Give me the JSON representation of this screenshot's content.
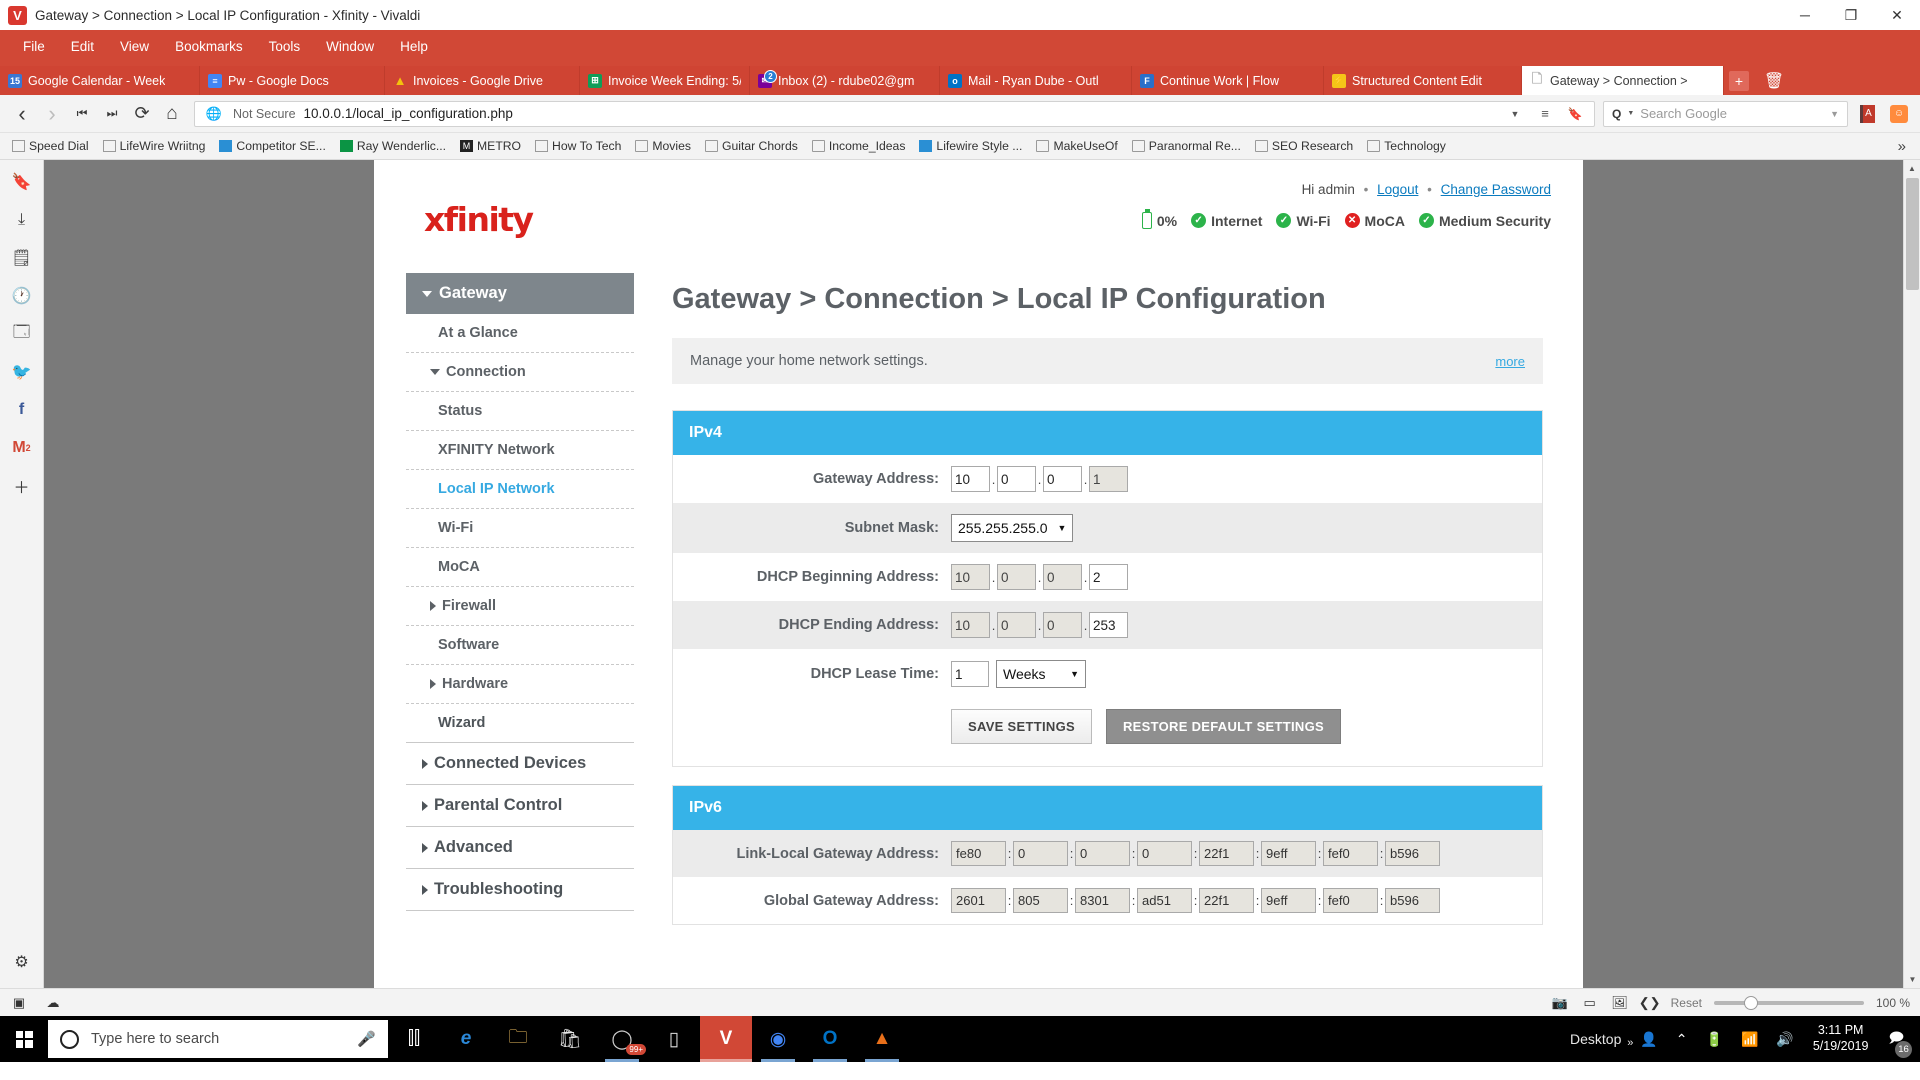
{
  "window": {
    "title": "Gateway > Connection > Local IP Configuration - Xfinity - Vivaldi",
    "logo_text": "V",
    "minimize": "─",
    "maximize": "❐",
    "close": "✕"
  },
  "menubar": {
    "items": [
      "File",
      "Edit",
      "View",
      "Bookmarks",
      "Tools",
      "Window",
      "Help"
    ]
  },
  "tabs": [
    {
      "label": "Google Calendar - Week",
      "favicon": "calendar-icon",
      "icon_glyph": "15",
      "icon_color": "#3a76d2",
      "badge": null,
      "active": false
    },
    {
      "label": "Pw - Google Docs",
      "favicon": "google-docs-icon",
      "icon_glyph": "≡",
      "icon_color": "#4285f4",
      "badge": null,
      "active": false
    },
    {
      "label": "Invoices - Google Drive",
      "favicon": "google-drive-icon",
      "icon_glyph": "▲",
      "icon_color": "#f4c20d",
      "badge": null,
      "active": false
    },
    {
      "label": "Invoice Week Ending: 5/",
      "favicon": "google-sheets-icon",
      "icon_glyph": "⊞",
      "icon_color": "#0f9d58",
      "badge": null,
      "active": false
    },
    {
      "label": "Inbox (2) - rdube02@gm",
      "favicon": "yahoo-mail-icon",
      "icon_glyph": "✉",
      "icon_color": "#7b0099",
      "badge": "2",
      "active": false
    },
    {
      "label": "Mail - Ryan Dube - Outl",
      "favicon": "outlook-icon",
      "icon_glyph": "o",
      "icon_color": "#0072c6",
      "badge": null,
      "active": false
    },
    {
      "label": "Continue Work | Flow",
      "favicon": "flow-icon",
      "icon_glyph": "F",
      "icon_color": "#2a6fc9",
      "badge": null,
      "active": false
    },
    {
      "label": "Structured Content Edit",
      "favicon": "lightning-icon",
      "icon_glyph": "⚡",
      "icon_color": "#f5c518",
      "badge": null,
      "active": false
    },
    {
      "label": "Gateway > Connection >",
      "favicon": "page-icon",
      "icon_glyph": "🗋",
      "icon_color": "#cfcfcf",
      "badge": null,
      "active": true
    }
  ],
  "tabbar_controls": {
    "new_tab": "+",
    "trash": "🗑"
  },
  "addressbar": {
    "back": "‹",
    "forward": "›",
    "rewind": "⏮",
    "fastforward": "⏭",
    "reload": "⟳",
    "home": "⌂",
    "security_icon": "globe-icon",
    "security_label": "Not Secure",
    "url": "10.0.0.1/local_ip_configuration.php",
    "dropdown": "▼",
    "reader": "≡",
    "bookmark": "🔖",
    "search_placeholder": "Search Google",
    "search_prefix": "Q",
    "search_dropdown": "▼",
    "extensions": [
      "dictionary-extension-icon",
      "reddit-extension-icon"
    ]
  },
  "bookmarks": [
    {
      "label": "Speed Dial",
      "icon": "speed-dial-icon"
    },
    {
      "label": "LifeWire Wriitng",
      "icon": "speed-dial-icon"
    },
    {
      "label": "Competitor SE...",
      "icon": "chart-icon"
    },
    {
      "label": "Ray Wenderlic...",
      "icon": "green-w-icon"
    },
    {
      "label": "METRO",
      "icon": "metro-m-icon"
    },
    {
      "label": "How To Tech",
      "icon": "speed-dial-icon"
    },
    {
      "label": "Movies",
      "icon": "folder-icon"
    },
    {
      "label": "Guitar Chords",
      "icon": "folder-icon"
    },
    {
      "label": "Income_Ideas",
      "icon": "folder-icon"
    },
    {
      "label": "Lifewire Style ...",
      "icon": "google-docs-icon"
    },
    {
      "label": "MakeUseOf",
      "icon": "folder-icon"
    },
    {
      "label": "Paranormal Re...",
      "icon": "folder-icon"
    },
    {
      "label": "SEO Research",
      "icon": "folder-icon"
    },
    {
      "label": "Technology",
      "icon": "folder-icon"
    }
  ],
  "bookmarks_overflow": "»",
  "panel_rail": [
    "bookmarks-panel-icon",
    "downloads-panel-icon",
    "notes-panel-icon",
    "history-panel-icon",
    "window-panel-icon",
    "twitter-panel-icon",
    "facebook-panel-icon",
    "gmail-panel-icon",
    "add-panel-icon"
  ],
  "panel_rail_gmail_badge": "2",
  "panel_rail_settings": "gear-icon",
  "router": {
    "brand": "xfinity",
    "account": {
      "greeting": "Hi admin",
      "logout": "Logout",
      "change_password": "Change Password"
    },
    "status": [
      {
        "label": "0%",
        "type": "battery"
      },
      {
        "label": "Internet",
        "type": "ok"
      },
      {
        "label": "Wi-Fi",
        "type": "ok"
      },
      {
        "label": "MoCA",
        "type": "bad"
      },
      {
        "label": "Medium Security",
        "type": "ok"
      }
    ],
    "sidebar": [
      {
        "label": "Gateway",
        "level": "head",
        "caret": "down",
        "active": false
      },
      {
        "label": "At a Glance",
        "level": "sub",
        "caret": "none",
        "active": false
      },
      {
        "label": "Connection",
        "level": "sub2",
        "caret": "down",
        "active": false
      },
      {
        "label": "Status",
        "level": "sub",
        "caret": "none",
        "active": false
      },
      {
        "label": "XFINITY Network",
        "level": "sub",
        "caret": "none",
        "active": false
      },
      {
        "label": "Local IP Network",
        "level": "sub",
        "caret": "none",
        "active": true
      },
      {
        "label": "Wi-Fi",
        "level": "sub",
        "caret": "none",
        "active": false
      },
      {
        "label": "MoCA",
        "level": "sub",
        "caret": "none",
        "active": false
      },
      {
        "label": "Firewall",
        "level": "sub2",
        "caret": "right",
        "active": false
      },
      {
        "label": "Software",
        "level": "sub",
        "caret": "none",
        "active": false
      },
      {
        "label": "Hardware",
        "level": "sub2",
        "caret": "right",
        "active": false
      },
      {
        "label": "Wizard",
        "level": "sub",
        "caret": "none",
        "active": false
      },
      {
        "label": "Connected Devices",
        "level": "top",
        "caret": "right",
        "active": false
      },
      {
        "label": "Parental Control",
        "level": "top",
        "caret": "right",
        "active": false
      },
      {
        "label": "Advanced",
        "level": "top",
        "caret": "right",
        "active": false
      },
      {
        "label": "Troubleshooting",
        "level": "top",
        "caret": "right",
        "active": false
      }
    ],
    "page_heading": "Gateway > Connection > Local IP Configuration",
    "description": "Manage your home network settings.",
    "description_more": "more",
    "ipv4": {
      "title": "IPv4",
      "gateway_address": {
        "label": "Gateway Address:",
        "octets": [
          "10",
          "0",
          "0",
          "1"
        ],
        "readonly": [
          false,
          false,
          false,
          true
        ]
      },
      "subnet_mask": {
        "label": "Subnet Mask:",
        "value": "255.255.255.0"
      },
      "dhcp_begin": {
        "label": "DHCP Beginning Address:",
        "octets": [
          "10",
          "0",
          "0",
          "2"
        ],
        "readonly": [
          true,
          true,
          true,
          false
        ]
      },
      "dhcp_end": {
        "label": "DHCP Ending Address:",
        "octets": [
          "10",
          "0",
          "0",
          "253"
        ],
        "readonly": [
          true,
          true,
          true,
          false
        ]
      },
      "lease_time": {
        "label": "DHCP Lease Time:",
        "value": "1",
        "unit": "Weeks"
      },
      "save_button": "SAVE SETTINGS",
      "restore_button": "RESTORE DEFAULT SETTINGS"
    },
    "ipv6": {
      "title": "IPv6",
      "link_local": {
        "label": "Link-Local Gateway Address:",
        "groups": [
          "fe80",
          "0",
          "0",
          "0",
          "22f1",
          "9eff",
          "fef0",
          "b596"
        ]
      },
      "global": {
        "label": "Global Gateway Address:",
        "groups": [
          "2601",
          "805",
          "8301",
          "ad51",
          "22f1",
          "9eff",
          "fef0",
          "b596"
        ]
      }
    }
  },
  "statusbar": {
    "left_icons": [
      "page-tile-icon",
      "cloud-icon"
    ],
    "right_icons": [
      "capture-icon",
      "tiling-icon",
      "image-toggle-icon",
      "developer-icon"
    ],
    "reset_label": "Reset",
    "zoom_value": "100 %"
  },
  "taskbar": {
    "start": "windows-start-icon",
    "search_placeholder": "Type here to search",
    "mic_icon": "microphone-icon",
    "apps": [
      {
        "name": "task-view-icon",
        "glyph": "⌸"
      },
      {
        "name": "edge-icon",
        "glyph": "e"
      },
      {
        "name": "file-explorer-icon",
        "glyph": "📁"
      },
      {
        "name": "microsoft-store-icon",
        "glyph": "🛍"
      },
      {
        "name": "notification-app-icon",
        "glyph": "●",
        "badge": "99+"
      },
      {
        "name": "phone-link-icon",
        "glyph": "📱"
      },
      {
        "name": "vivaldi-icon",
        "glyph": "V",
        "active": true
      },
      {
        "name": "chrome-icon",
        "glyph": "◉"
      },
      {
        "name": "outlook-icon",
        "glyph": "O"
      },
      {
        "name": "vlc-icon",
        "glyph": "▲"
      }
    ],
    "desktop_label": "Desktop",
    "desktop_chevron": "»",
    "tray": [
      "people-icon",
      "show-hidden-icons-chevron",
      "battery-icon",
      "wifi-icon",
      "volume-icon"
    ],
    "time": "3:11 PM",
    "date": "5/19/2019",
    "notification_icon": "action-center-icon",
    "notification_count": "16"
  }
}
